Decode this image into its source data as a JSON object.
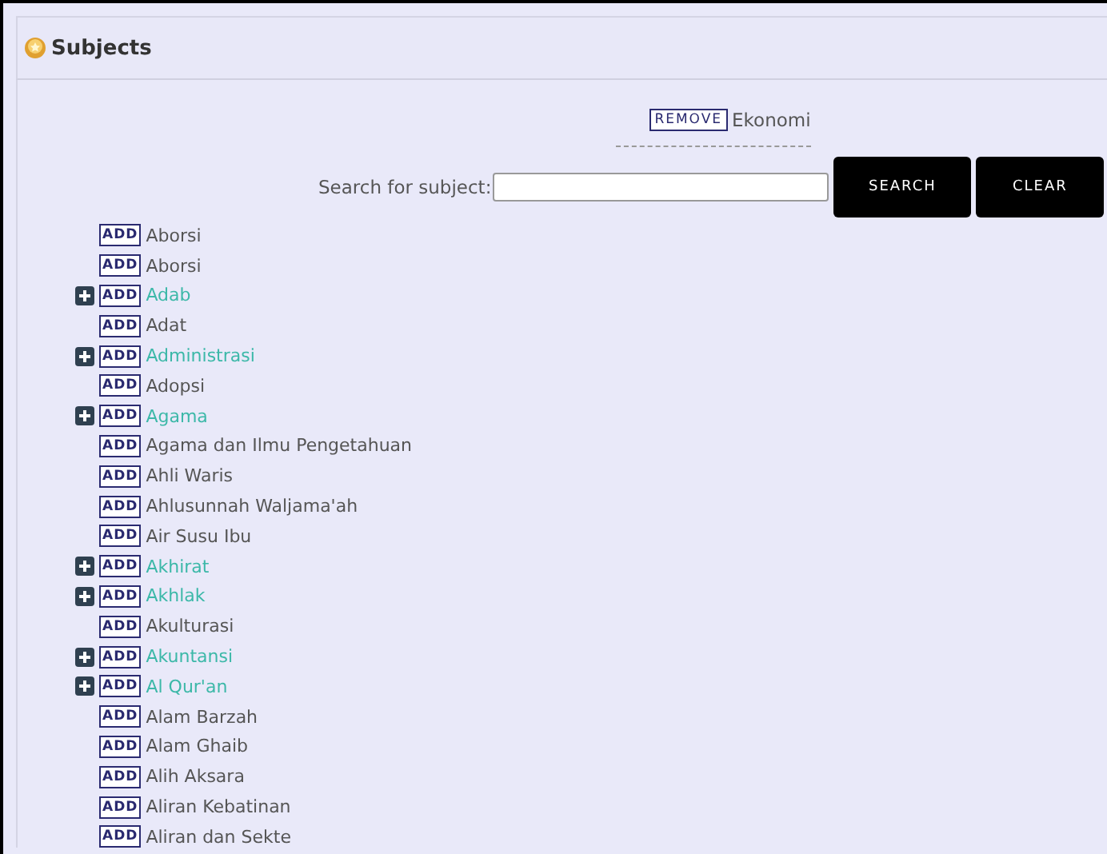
{
  "panel": {
    "title": "Subjects"
  },
  "selected_subject": {
    "remove_label": "REMOVE",
    "name": "Ekonomi"
  },
  "search": {
    "label": "Search for subject:",
    "search_button": "SEARCH",
    "clear_button": "CLEAR"
  },
  "subjects": [
    {
      "add_label": "ADD",
      "name": "Aborsi",
      "expandable": false
    },
    {
      "add_label": "ADD",
      "name": "Aborsi",
      "expandable": false
    },
    {
      "add_label": "ADD",
      "name": "Adab",
      "expandable": true
    },
    {
      "add_label": "ADD",
      "name": "Adat",
      "expandable": false
    },
    {
      "add_label": "ADD",
      "name": "Administrasi",
      "expandable": true
    },
    {
      "add_label": "ADD",
      "name": "Adopsi",
      "expandable": false
    },
    {
      "add_label": "ADD",
      "name": "Agama",
      "expandable": true
    },
    {
      "add_label": "ADD",
      "name": "Agama dan Ilmu Pengetahuan",
      "expandable": false
    },
    {
      "add_label": "ADD",
      "name": "Ahli Waris",
      "expandable": false
    },
    {
      "add_label": "ADD",
      "name": "Ahlusunnah Waljama'ah",
      "expandable": false
    },
    {
      "add_label": "ADD",
      "name": "Air Susu Ibu",
      "expandable": false
    },
    {
      "add_label": "ADD",
      "name": "Akhirat",
      "expandable": true
    },
    {
      "add_label": "ADD",
      "name": "Akhlak",
      "expandable": true
    },
    {
      "add_label": "ADD",
      "name": "Akulturasi",
      "expandable": false
    },
    {
      "add_label": "ADD",
      "name": "Akuntansi",
      "expandable": true
    },
    {
      "add_label": "ADD",
      "name": "Al Qur'an",
      "expandable": true
    },
    {
      "add_label": "ADD",
      "name": "Alam Barzah",
      "expandable": false
    },
    {
      "add_label": "ADD",
      "name": "Alam Ghaib",
      "expandable": false
    },
    {
      "add_label": "ADD",
      "name": "Alih Aksara",
      "expandable": false
    },
    {
      "add_label": "ADD",
      "name": "Aliran Kebatinan",
      "expandable": false
    },
    {
      "add_label": "ADD",
      "name": "Aliran dan Sekte",
      "expandable": false
    }
  ]
}
